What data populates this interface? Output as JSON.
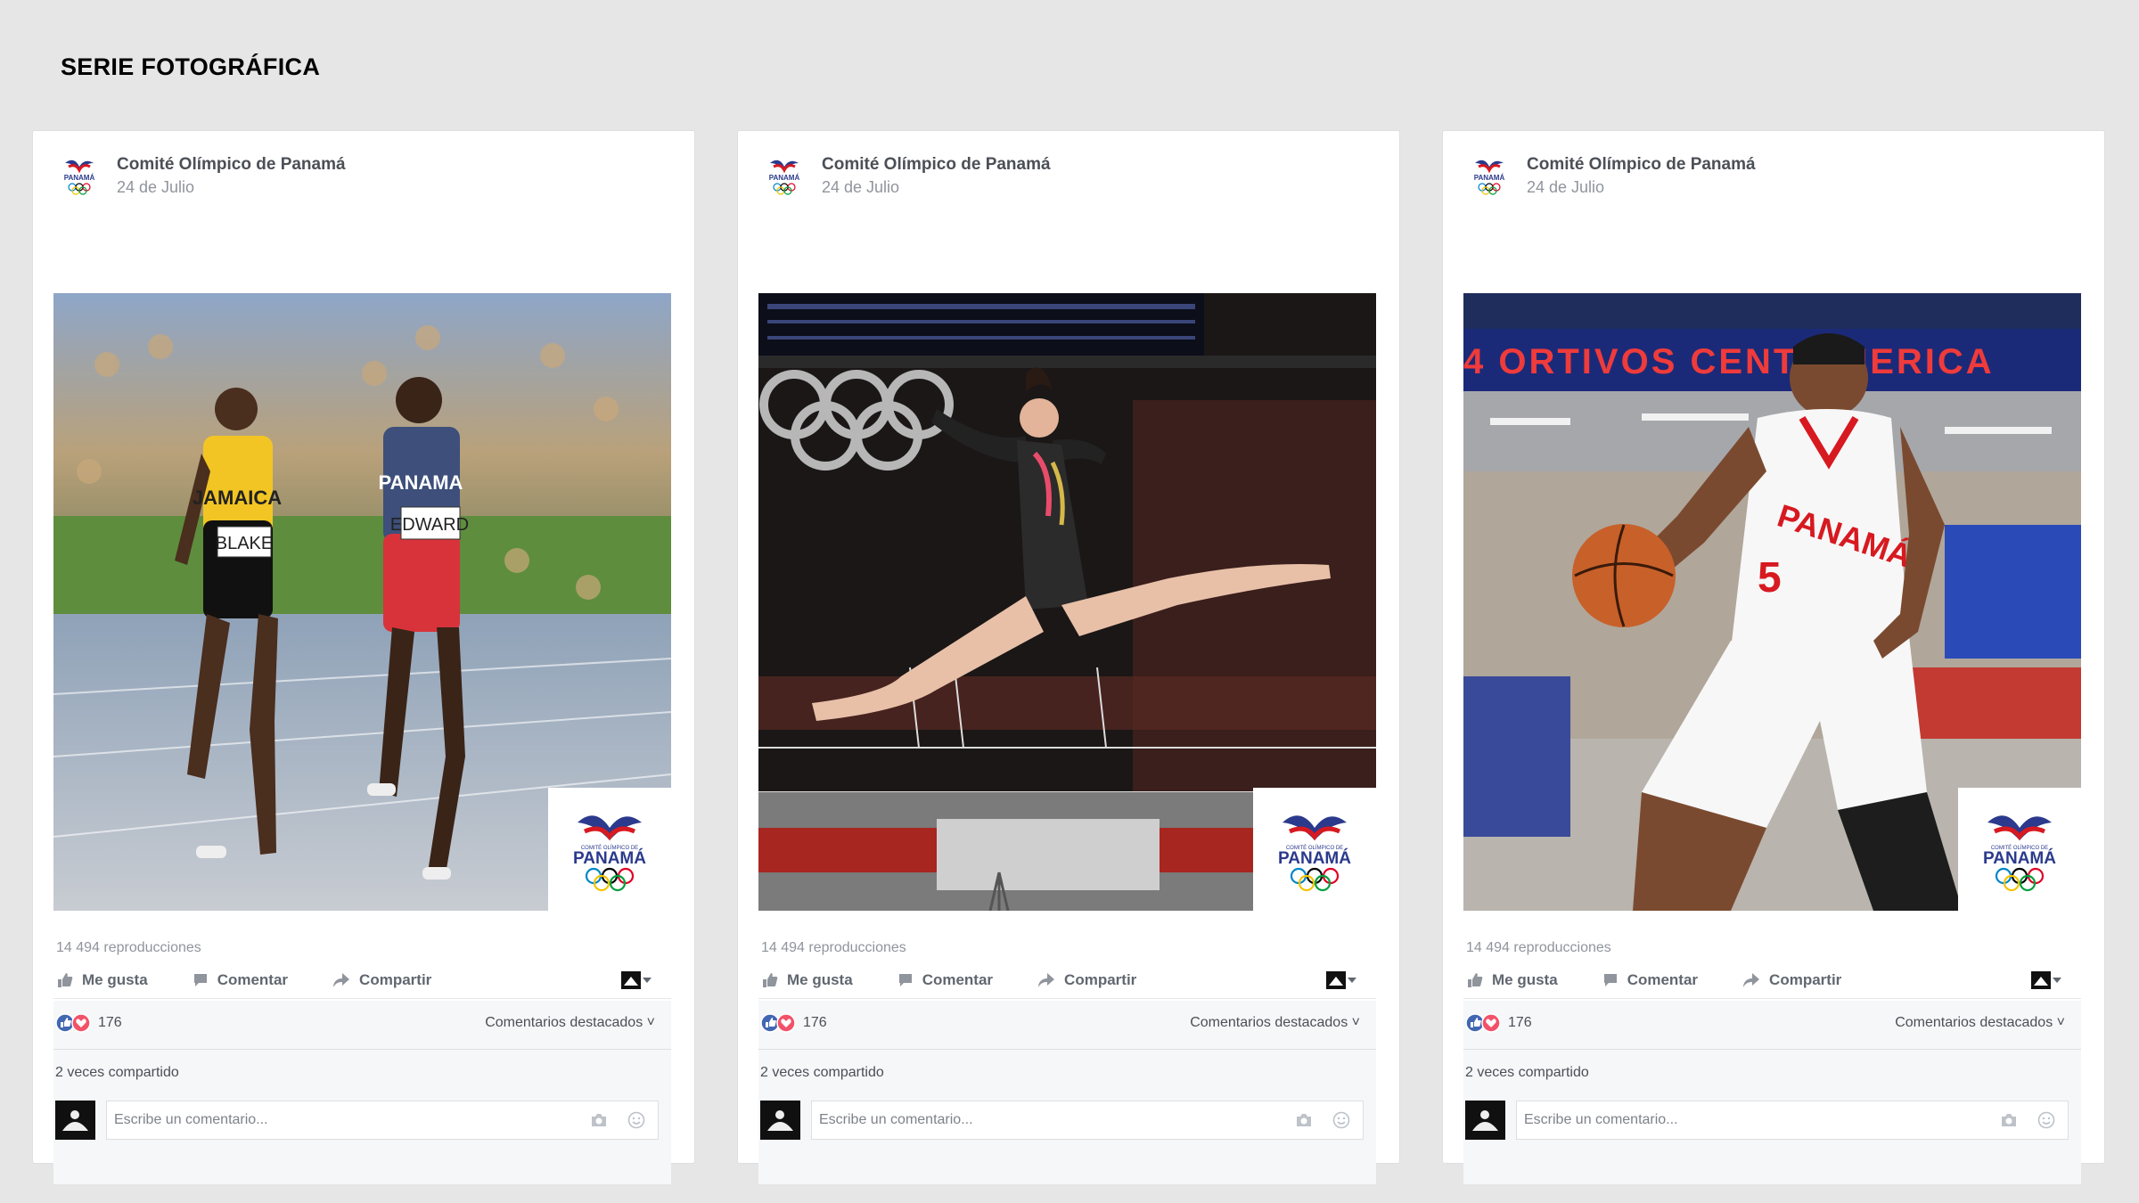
{
  "page": {
    "title": "SERIE FOTOGRÁFICA"
  },
  "colors": {
    "accent": "#4267b2",
    "love": "#f25268",
    "panama_red": "#d71920",
    "panama_blue": "#2b3a8c"
  },
  "posts": [
    {
      "author": "Comité Olímpico de Panamá",
      "date": "24 de Julio",
      "photo_subject": "athletics",
      "views": "14 494 reproducciones",
      "actions": {
        "like": "Me gusta",
        "comment": "Comentar",
        "share": "Compartir"
      },
      "reaction_count": "176",
      "featured_label": "Comentarios destacados ˅",
      "shared": "2 veces compartido",
      "comment_placeholder": "Escribe un comentario...",
      "jersey_text": [
        "JAMAICA",
        "BLAKE",
        "PANAMA",
        "EDWARD"
      ]
    },
    {
      "author": "Comité Olímpico de Panamá",
      "date": "24 de Julio",
      "photo_subject": "gymnastics",
      "views": "14 494 reproducciones",
      "actions": {
        "like": "Me gusta",
        "comment": "Comentar",
        "share": "Compartir"
      },
      "reaction_count": "176",
      "featured_label": "Comentarios destacados ˅",
      "shared": "2 veces compartido",
      "comment_placeholder": "Escribe un comentario..."
    },
    {
      "author": "Comité Olímpico de Panamá",
      "date": "24 de Julio",
      "photo_subject": "basketball",
      "views": "14 494 reproducciones",
      "actions": {
        "like": "Me gusta",
        "comment": "Comentar",
        "share": "Compartir"
      },
      "reaction_count": "176",
      "featured_label": "Comentarios destacados ˅",
      "shared": "2 veces compartido",
      "comment_placeholder": "Escribe un comentario...",
      "banner_text": "4 ORTIVOS CENT AMERICA",
      "jersey_text": [
        "PANAMÁ",
        "5"
      ]
    }
  ],
  "logo": {
    "text": "PANAMÁ",
    "small_text": "COMITÉ OLÍMPICO DE"
  }
}
